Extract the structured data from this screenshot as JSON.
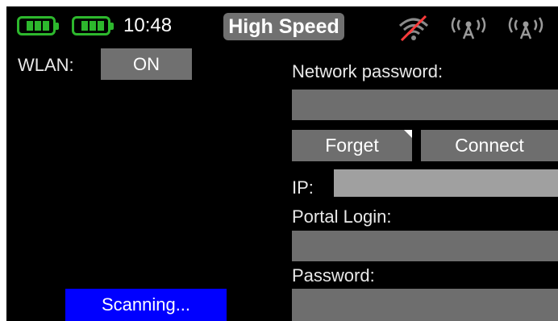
{
  "status_bar": {
    "time": "10:48",
    "mode": "High Speed",
    "battery_color": "#2db82d",
    "icons": [
      "battery-icon",
      "battery-icon",
      "wifi-disabled-icon",
      "antenna-icon",
      "antenna-icon"
    ]
  },
  "wlan": {
    "label": "WLAN:",
    "toggle_value": "ON"
  },
  "network": {
    "password_label": "Network password:",
    "password_value": "",
    "forget_label": "Forget",
    "connect_label": "Connect",
    "ip_label": "IP:",
    "ip_value": "",
    "portal_login_label": "Portal Login:",
    "portal_login_value": "",
    "portal_password_label": "Password:",
    "portal_password_value": ""
  },
  "scan": {
    "status": "Scanning..."
  },
  "colors": {
    "background": "#000000",
    "control": "#6e6e6e",
    "ip_field": "#a0a0a0",
    "scan_bar": "#0000ff",
    "wifi_slash": "#ff3b3b"
  }
}
